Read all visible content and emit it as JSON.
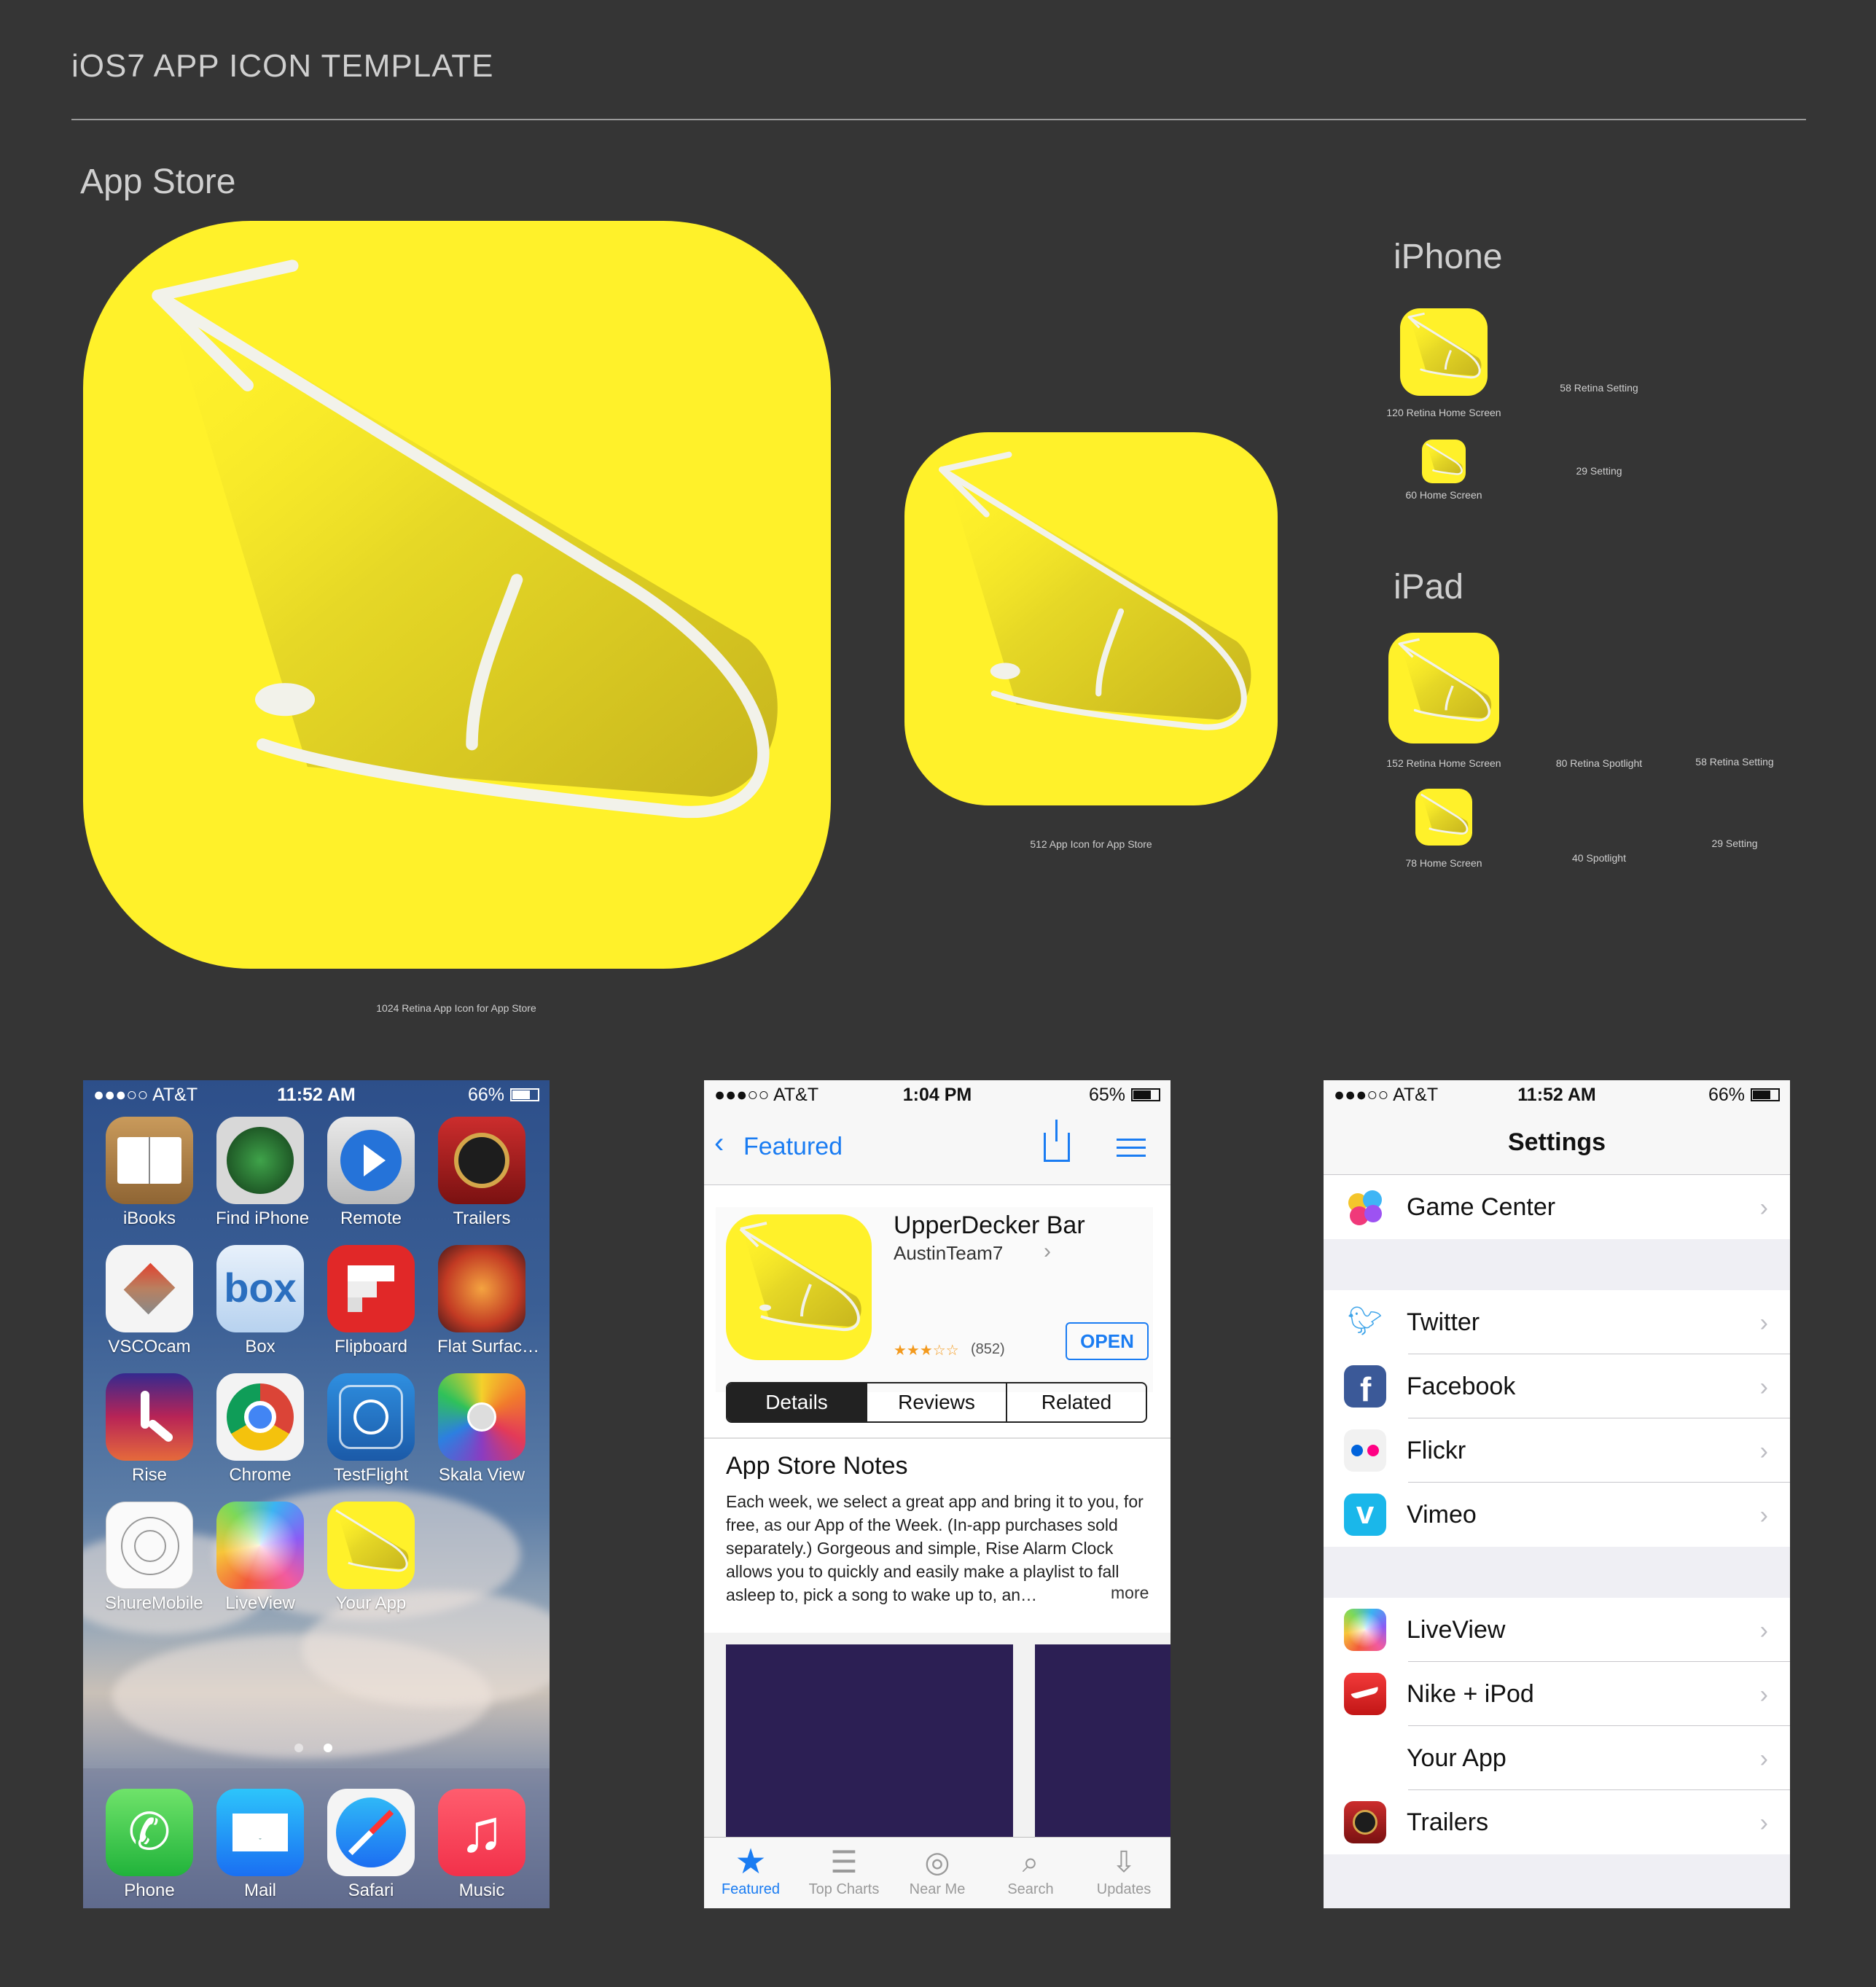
{
  "page": {
    "title": "iOS7 APP ICON TEMPLATE",
    "section_app_store": "App Store",
    "section_iphone": "iPhone",
    "section_ipad": "iPad"
  },
  "icon_captions": {
    "app_store_1024": "1024 Retina App Icon for App Store",
    "app_store_512": "512 App Icon for App Store",
    "iphone": [
      "120 Retina Home Screen",
      "58 Retina Setting",
      "60 Home Screen",
      "29 Setting"
    ],
    "ipad": [
      "152 Retina Home Screen",
      "80 Retina Spotlight",
      "58 Retina Setting",
      "78 Home Screen",
      "40 Spotlight",
      "29 Setting"
    ]
  },
  "colors": {
    "icon_yellow": "#fff12a",
    "background": "#353535",
    "ios_blue": "#1a7cf2"
  },
  "home_screen": {
    "status": {
      "carrier": "●●●○○ AT&T",
      "time": "11:52 AM",
      "battery": "66%"
    },
    "apps": [
      {
        "label": "iBooks",
        "icon": "ibooks-icon"
      },
      {
        "label": "Find iPhone",
        "icon": "find-iphone-icon"
      },
      {
        "label": "Remote",
        "icon": "remote-icon"
      },
      {
        "label": "Trailers",
        "icon": "trailers-icon"
      },
      {
        "label": "VSCOcam",
        "icon": "vscocam-icon"
      },
      {
        "label": "Box",
        "icon": "box-icon"
      },
      {
        "label": "Flipboard",
        "icon": "flipboard-icon"
      },
      {
        "label": "Flat Surfac…",
        "icon": "flat-surface-icon"
      },
      {
        "label": "Rise",
        "icon": "rise-icon"
      },
      {
        "label": "Chrome",
        "icon": "chrome-icon"
      },
      {
        "label": "TestFlight",
        "icon": "testflight-icon"
      },
      {
        "label": "Skala View",
        "icon": "skala-view-icon"
      },
      {
        "label": "ShureMobile",
        "icon": "shuremobile-icon"
      },
      {
        "label": "LiveView",
        "icon": "liveview-icon"
      },
      {
        "label": "Your App",
        "icon": "your-app-icon"
      }
    ],
    "box_logo_text": "box",
    "dock": [
      {
        "label": "Phone",
        "icon": "phone-icon"
      },
      {
        "label": "Mail",
        "icon": "mail-icon"
      },
      {
        "label": "Safari",
        "icon": "safari-icon"
      },
      {
        "label": "Music",
        "icon": "music-icon"
      }
    ]
  },
  "app_store_screen": {
    "status": {
      "carrier": "●●●○○ AT&T",
      "time": "1:04 PM",
      "battery": "65%"
    },
    "back_label": "Featured",
    "app_name": "UpperDecker Bar",
    "developer": "AustinTeam7",
    "rating_count": "(852)",
    "open_button": "OPEN",
    "segments": [
      "Details",
      "Reviews",
      "Related"
    ],
    "notes_title": "App Store Notes",
    "notes_text": "Each week, we select a great app and bring it to you, for free, as our App of the Week. (In-app purchases sold separately.) Gorgeous and simple, Rise Alarm Clock allows you to quickly and easily make a playlist to fall asleep to, pick a song to wake up to, an…",
    "more_link": "more",
    "tabs": [
      "Featured",
      "Top Charts",
      "Near Me",
      "Search",
      "Updates"
    ]
  },
  "settings_screen": {
    "status": {
      "carrier": "●●●○○ AT&T",
      "time": "11:52 AM",
      "battery": "66%"
    },
    "title": "Settings",
    "rows": [
      "Game Center",
      "Twitter",
      "Facebook",
      "Flickr",
      "Vimeo",
      "LiveView",
      "Nike + iPod",
      "Your App",
      "Trailers"
    ]
  }
}
